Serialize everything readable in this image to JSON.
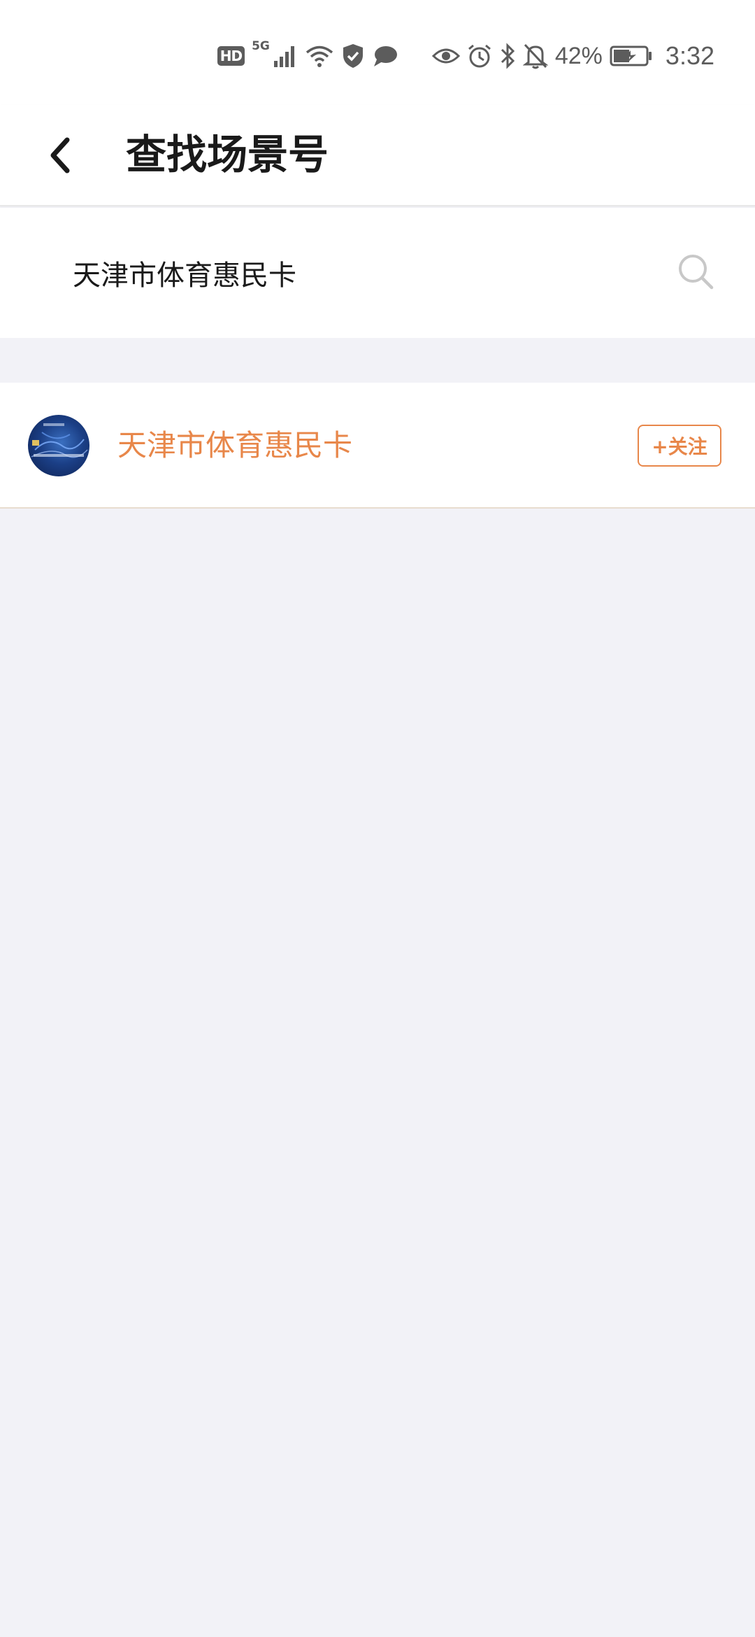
{
  "status_bar": {
    "hd": "HD",
    "network": "5G",
    "battery_pct": "42%",
    "time": "3:32",
    "icons": [
      "hd-icon",
      "signal-icon",
      "wifi-icon",
      "shield-icon",
      "message-icon",
      "eye-icon",
      "alarm-icon",
      "bluetooth-icon",
      "bell-off-icon",
      "battery-icon"
    ]
  },
  "header": {
    "title": "查找场景号",
    "back_icon": "chevron-left-icon"
  },
  "search": {
    "value": "天津市体育惠民卡",
    "icon": "search-icon"
  },
  "results": [
    {
      "name": "天津市体育惠民卡",
      "follow_label": "+关注"
    }
  ],
  "colors": {
    "accent": "#e8874a",
    "background": "#f2f2f7",
    "surface": "#ffffff",
    "status_icon": "#5c5c5c"
  }
}
